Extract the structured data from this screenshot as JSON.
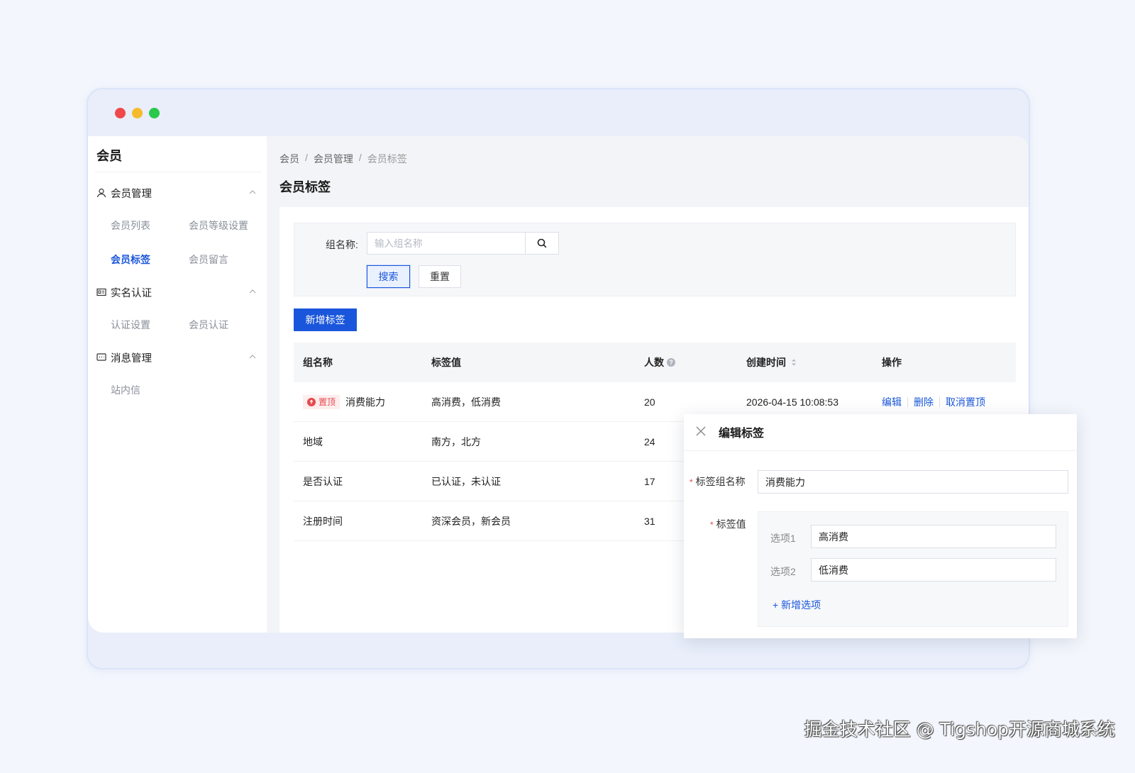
{
  "sidebar": {
    "title": "会员",
    "groups": [
      {
        "label": "会员管理",
        "items": [
          "会员列表",
          "会员等级设置",
          "会员标签",
          "会员留言"
        ]
      },
      {
        "label": "实名认证",
        "items": [
          "认证设置",
          "会员认证"
        ]
      },
      {
        "label": "消息管理",
        "items": [
          "站内信"
        ]
      }
    ],
    "active_item": "会员标签"
  },
  "breadcrumb": [
    "会员",
    "会员管理",
    "会员标签"
  ],
  "page_title": "会员标签",
  "filter": {
    "label": "组名称:",
    "placeholder": "输入组名称",
    "search_label": "搜索",
    "reset_label": "重置"
  },
  "add_button": "新增标签",
  "table": {
    "columns": [
      "组名称",
      "标签值",
      "人数",
      "创建时间",
      "操作"
    ],
    "rows": [
      {
        "pinned_tag": "置顶",
        "name": "消费能力",
        "values": "高消费，低消费",
        "count": "20",
        "created": "2026-04-15 10:08:53",
        "actions": [
          "编辑",
          "删除",
          "取消置顶"
        ]
      },
      {
        "name": "地域",
        "values": "南方，北方",
        "count": "24"
      },
      {
        "name": "是否认证",
        "values": "已认证，未认证",
        "count": "17"
      },
      {
        "name": "注册时间",
        "values": "资深会员，新会员",
        "count": "31"
      }
    ]
  },
  "edit_popover": {
    "title": "编辑标签",
    "name_label": "标签组名称",
    "name_value": "消费能力",
    "values_label": "标签值",
    "options": [
      {
        "label": "选项1",
        "value": "高消费"
      },
      {
        "label": "选项2",
        "value": "低消费"
      }
    ],
    "add_option": "+ 新增选项"
  },
  "watermark": "掘金技术社区 @ Tigshop开源商城系统",
  "colors": {
    "accent": "#1a56db",
    "danger": "#e5484d"
  }
}
